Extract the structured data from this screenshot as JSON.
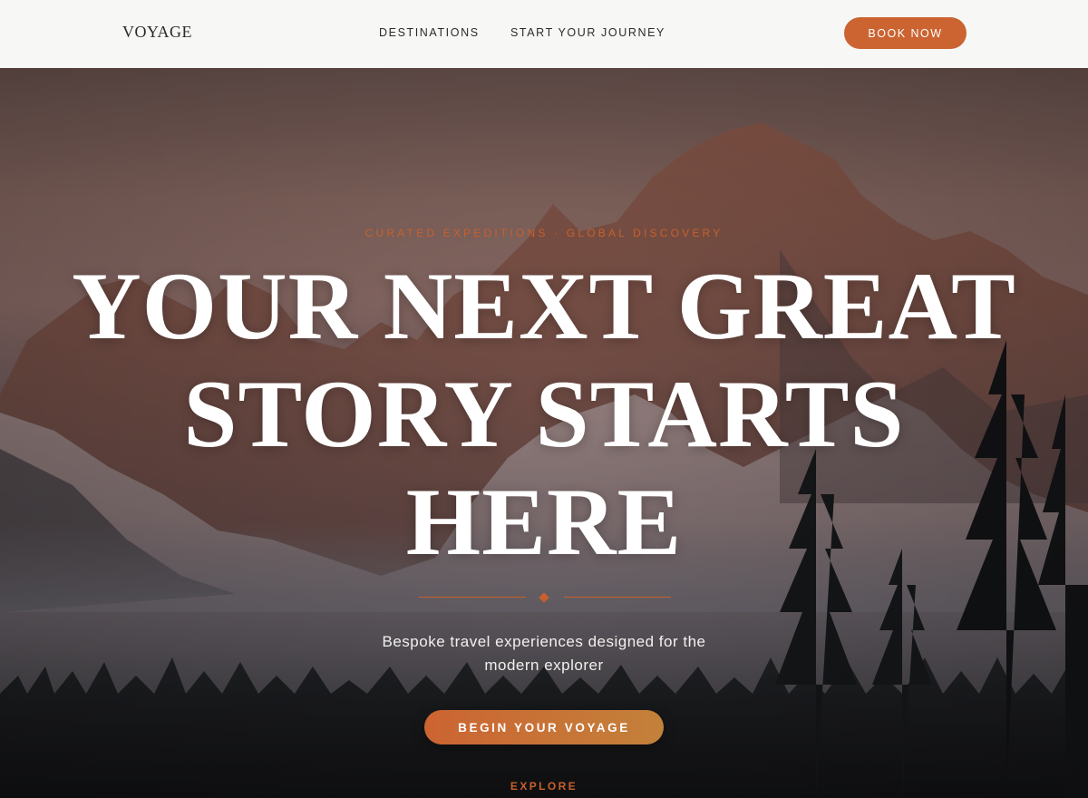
{
  "header": {
    "logo": "VOYAGE",
    "nav": [
      "DESTINATIONS",
      "START YOUR JOURNEY"
    ],
    "book_label": "BOOK NOW"
  },
  "hero": {
    "eyebrow": "CURATED EXPEDITIONS · GLOBAL DISCOVERY",
    "headline_lines": [
      "YOUR NEXT GREAT",
      "STORY STARTS",
      "HERE"
    ],
    "subtitle": "Bespoke travel experiences designed for the modern explorer",
    "cta_label": "BEGIN YOUR VOYAGE",
    "explore_label": "EXPLORE"
  },
  "colors": {
    "accent": "#c8602b",
    "header_bg": "#f7f7f6",
    "cta_gradient_start": "#cc6432",
    "cta_gradient_end": "#c3813a"
  },
  "icons": {
    "divider_ornament": "diamond-icon"
  }
}
